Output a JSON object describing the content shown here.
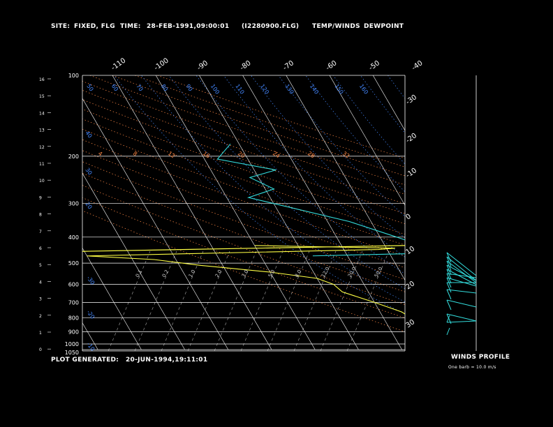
{
  "header": {
    "site_label": "SITE:",
    "site_value": "FIXED, FLG",
    "time_label": "TIME:",
    "time_value": "28-FEB-1991,09:00:01",
    "file": "(I2280900.FLG)",
    "temp_winds_legend": "TEMP/WINDS",
    "dewpoint_legend": "DEWPOINT"
  },
  "footer": {
    "plot_generated_label": "PLOT GENERATED:",
    "plot_generated_value": "20-JUN-1994,19:11:01",
    "winds_profile_label": "WINDS PROFILE",
    "barb_note": "One barb = 10.0 m/s"
  },
  "colors": {
    "temperature": "#33dddd",
    "dewpoint": "#ffff44",
    "isotherm": "#ffffff",
    "pressure_line": "#ffffff",
    "dry_adiabat": "#ff8844",
    "moist_adiabat": "#4488ff",
    "mixing_ratio": "#aaaaaa"
  },
  "chart_data": {
    "type": "line",
    "skew_t": true,
    "y_scale": "log-pressure",
    "pressure_levels": [
      "100",
      "200",
      "300",
      "400",
      "500",
      "600",
      "700",
      "800",
      "900",
      "1000",
      "1050"
    ],
    "height_ticks": [
      "16",
      "15",
      "14",
      "13",
      "12",
      "11",
      "10",
      "9",
      "8",
      "7",
      "6",
      "5",
      "4",
      "3",
      "2",
      "1",
      "0"
    ],
    "top_isotherm_labels": [
      "-110",
      "-100",
      "-90",
      "-80",
      "-70",
      "-60",
      "-50",
      "-40"
    ],
    "right_isotherm_labels": [
      "-30",
      "-20",
      "-10",
      "0",
      "10",
      "20",
      "30"
    ],
    "dry_adiabat_labels": [
      "4",
      "8",
      "12",
      "16",
      "20",
      "24",
      "28",
      "32"
    ],
    "moist_adiabat_labels": [
      "50",
      "60",
      "70",
      "80",
      "90",
      "100",
      "110",
      "120",
      "130",
      "140",
      "150",
      "160"
    ],
    "mixing_ratio_labels": [
      "0.1",
      "0.2",
      "1.0",
      "2.0",
      "3.0",
      "5.0",
      "8.0",
      "12.0",
      "20.0",
      "50.0"
    ],
    "series": [
      {
        "name": "TEMP/WINDS",
        "color": "#33dddd",
        "points": [
          [
            180,
            -62
          ],
          [
            205,
            -67
          ],
          [
            225,
            -55
          ],
          [
            240,
            -62
          ],
          [
            265,
            -58
          ],
          [
            285,
            -65
          ],
          [
            300,
            -60
          ],
          [
            350,
            -45
          ],
          [
            395,
            -37
          ],
          [
            420,
            -33
          ],
          [
            432,
            -30
          ],
          [
            455,
            -34
          ],
          [
            475,
            -30
          ],
          [
            500,
            -29
          ],
          [
            540,
            -26
          ],
          [
            570,
            -27
          ],
          [
            600,
            -26
          ],
          [
            640,
            -23
          ],
          [
            700,
            -17
          ],
          [
            750,
            -10
          ],
          [
            810,
            -2
          ],
          [
            820,
            -15
          ]
        ]
      },
      {
        "name": "DEWPOINT",
        "color": "#ffff44",
        "points": [
          [
            430,
            -70
          ],
          [
            440,
            -38
          ],
          [
            445,
            -42
          ],
          [
            470,
            -110
          ],
          [
            485,
            -95
          ],
          [
            510,
            -85
          ],
          [
            540,
            -70
          ],
          [
            570,
            -60
          ],
          [
            600,
            -57
          ],
          [
            640,
            -56
          ],
          [
            700,
            -50
          ],
          [
            760,
            -45
          ],
          [
            790,
            -44
          ],
          [
            810,
            -45
          ],
          [
            830,
            -43
          ]
        ]
      }
    ]
  }
}
